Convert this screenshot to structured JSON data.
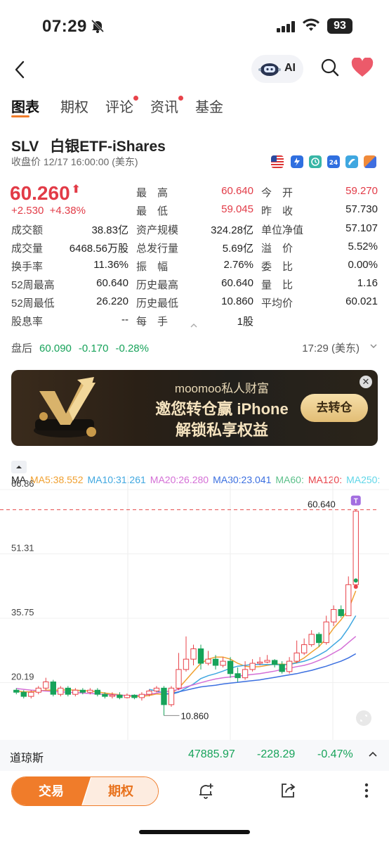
{
  "status_bar": {
    "time": "07:29",
    "battery": "93"
  },
  "nav": {
    "ai_label": "AI"
  },
  "tabs": [
    {
      "label": "图表",
      "active": true,
      "dot": false
    },
    {
      "label": "期权",
      "active": false,
      "dot": false
    },
    {
      "label": "评论",
      "active": false,
      "dot": true
    },
    {
      "label": "资讯",
      "active": false,
      "dot": true
    },
    {
      "label": "基金",
      "active": false,
      "dot": false
    }
  ],
  "quote": {
    "symbol": "SLV",
    "name": "白银ETF-iShares",
    "close_time": "收盘价 12/17 16:00:00 (美东)",
    "price": "60.260",
    "change": "+2.530",
    "change_pct": "+4.38%"
  },
  "stats": [
    {
      "label": "最　高",
      "value": "60.640",
      "color": "red"
    },
    {
      "label": "今　开",
      "value": "59.270",
      "color": "red"
    },
    {
      "label": "最　低",
      "value": "59.045",
      "color": "red"
    },
    {
      "label": "昨　收",
      "value": "57.730",
      "color": ""
    },
    {
      "label": "成交额",
      "value": "38.83亿",
      "color": ""
    },
    {
      "label": "资产规模",
      "value": "324.28亿",
      "color": ""
    },
    {
      "label": "单位净值",
      "value": "57.107",
      "color": ""
    },
    {
      "label": "成交量",
      "value": "6468.56万股",
      "color": ""
    },
    {
      "label": "总发行量",
      "value": "5.69亿",
      "color": ""
    },
    {
      "label": "溢　价",
      "value": "5.52%",
      "color": ""
    },
    {
      "label": "换手率",
      "value": "11.36%",
      "color": ""
    },
    {
      "label": "振　幅",
      "value": "2.76%",
      "color": ""
    },
    {
      "label": "委　比",
      "value": "0.00%",
      "color": ""
    },
    {
      "label": "52周最高",
      "value": "60.640",
      "color": ""
    },
    {
      "label": "历史最高",
      "value": "60.640",
      "color": ""
    },
    {
      "label": "量　比",
      "value": "1.16",
      "color": ""
    },
    {
      "label": "52周最低",
      "value": "26.220",
      "color": ""
    },
    {
      "label": "历史最低",
      "value": "10.860",
      "color": ""
    },
    {
      "label": "平均价",
      "value": "60.021",
      "color": ""
    },
    {
      "label": "股息率",
      "value": "--",
      "color": ""
    },
    {
      "label": "每　手",
      "value": "1股",
      "color": ""
    }
  ],
  "after_hours": {
    "label": "盘后",
    "price": "60.090",
    "change": "-0.170",
    "pct": "-0.28%",
    "time": "17:29 (美东)"
  },
  "banner": {
    "line1": "moomoo私人财富",
    "line2": "邀您转仓赢 iPhone",
    "line3": "解锁私享权益",
    "button": "去转仓"
  },
  "ma_legend": [
    {
      "label": "MA",
      "color": "#222222"
    },
    {
      "label": "MA5:38.552",
      "color": "#f0a030"
    },
    {
      "label": "MA10:31.261",
      "color": "#3fa7e0"
    },
    {
      "label": "MA20:26.280",
      "color": "#d46fd6"
    },
    {
      "label": "MA30:23.041",
      "color": "#3b6fe0"
    },
    {
      "label": "MA60:",
      "color": "#5cc08a"
    },
    {
      "label": "MA120:",
      "color": "#e8434a"
    },
    {
      "label": "MA250:",
      "color": "#5fd6e8"
    }
  ],
  "chart_data": {
    "type": "candlestick",
    "y_ticks": [
      "66.86",
      "51.31",
      "35.75",
      "20.19"
    ],
    "ylim": [
      4.64,
      66.86
    ],
    "high_label": "60.640",
    "low_label": "10.860",
    "marker": "T",
    "candles": [
      [
        17,
        16.5,
        17.5,
        16
      ],
      [
        16.5,
        15.5,
        17,
        15
      ],
      [
        15.5,
        16.5,
        17,
        15
      ],
      [
        16.5,
        17.5,
        18,
        16
      ],
      [
        17.5,
        19,
        20,
        17
      ],
      [
        19,
        16,
        19.5,
        15.5
      ],
      [
        16,
        17.5,
        18,
        15.5
      ],
      [
        17.5,
        16,
        18,
        15.5
      ],
      [
        16,
        17,
        17.5,
        15.5
      ],
      [
        17,
        16.5,
        17.5,
        16
      ],
      [
        16.5,
        17,
        17.5,
        16
      ],
      [
        17,
        16,
        17.5,
        15.5
      ],
      [
        16,
        15.5,
        16.5,
        15
      ],
      [
        15.5,
        15.8,
        16.5,
        15
      ],
      [
        15.8,
        15.2,
        16.5,
        14.8
      ],
      [
        15.2,
        15.8,
        16.2,
        15
      ],
      [
        15.8,
        15.2,
        16,
        14.8
      ],
      [
        15.2,
        16,
        16.5,
        14.5
      ],
      [
        16,
        16.8,
        17.2,
        15.5
      ],
      [
        16.8,
        17.5,
        18,
        16.5
      ],
      [
        17.5,
        13.5,
        18,
        10.86
      ],
      [
        13.5,
        17.5,
        18,
        13
      ],
      [
        17.5,
        22,
        26,
        17
      ],
      [
        22,
        24.5,
        30,
        21.5
      ],
      [
        24.5,
        27,
        28,
        23
      ],
      [
        27,
        23.5,
        28,
        22
      ],
      [
        23.5,
        24.5,
        26.5,
        23
      ],
      [
        24.5,
        23,
        25.5,
        22
      ],
      [
        23,
        24,
        25,
        22.5
      ],
      [
        24,
        21,
        25,
        20
      ],
      [
        21,
        20,
        22.5,
        19
      ],
      [
        20,
        22,
        24,
        19.5
      ],
      [
        22,
        23.5,
        24.5,
        21.5
      ],
      [
        23.5,
        23.8,
        25,
        23
      ],
      [
        23.8,
        24.2,
        25.5,
        23.5
      ],
      [
        24.2,
        23.2,
        24.5,
        22.5
      ],
      [
        23.2,
        21.5,
        24,
        21
      ],
      [
        21.5,
        24,
        25,
        21
      ],
      [
        24,
        26,
        29,
        23.5
      ],
      [
        26,
        28,
        29.5,
        25.5
      ],
      [
        28,
        30.5,
        31.5,
        27.5
      ],
      [
        30.5,
        28.5,
        31,
        27.5
      ],
      [
        28.5,
        33.5,
        35,
        28
      ],
      [
        33.5,
        36.5,
        37.5,
        32.5
      ],
      [
        36.5,
        35,
        37.5,
        34.5
      ],
      [
        35,
        42.5,
        44.5,
        35
      ],
      [
        42.5,
        60.26,
        60.64,
        42
      ]
    ],
    "ma_lines": [
      {
        "name": "MA5",
        "color": "#f0a030",
        "values": [
          16.8,
          16.6,
          16.6,
          16.8,
          17,
          17,
          17,
          17.1,
          17,
          16.9,
          16.8,
          16.6,
          16.3,
          16.1,
          15.9,
          15.6,
          15.5,
          15.5,
          15.7,
          16.1,
          16,
          16.2,
          17.5,
          19.5,
          21.5,
          23.5,
          24.5,
          25,
          25,
          24.5,
          23.5,
          22.8,
          22.6,
          22.7,
          23,
          23.3,
          23.3,
          23.2,
          23.8,
          24.8,
          26.2,
          27.5,
          29.5,
          32,
          34,
          36.5,
          41
        ]
      },
      {
        "name": "MA10",
        "color": "#3fa7e0",
        "values": [
          null,
          null,
          null,
          null,
          null,
          null,
          null,
          null,
          null,
          null,
          null,
          null,
          null,
          null,
          null,
          null,
          null,
          null,
          17.2,
          16.8,
          16.3,
          16,
          16.5,
          17.5,
          18.5,
          19.8,
          20.5,
          21,
          21.6,
          22.3,
          22.8,
          23,
          23.2,
          23.2,
          23.2,
          23.2,
          23.1,
          23.2,
          23.6,
          24,
          24.6,
          25.5,
          26.5,
          28,
          29.5,
          32,
          35
        ]
      },
      {
        "name": "MA20",
        "color": "#d46fd6",
        "values": [
          17.4,
          17.2,
          17,
          16.9,
          16.8,
          16.7,
          16.6,
          16.5,
          16.4,
          16.3,
          16.2,
          16.1,
          16,
          15.9,
          15.8,
          15.7,
          15.7,
          15.8,
          16,
          16.3,
          16.6,
          16.8,
          17.2,
          17.8,
          18.3,
          18.8,
          19.3,
          19.7,
          20,
          20.2,
          20.4,
          20.6,
          20.8,
          21,
          21.3,
          21.6,
          22,
          22.3,
          22.7,
          23,
          23.5,
          24.2,
          25,
          26,
          27,
          28.5,
          30
        ]
      },
      {
        "name": "MA30",
        "color": "#3b6fe0",
        "values": [
          null,
          null,
          null,
          null,
          null,
          null,
          null,
          null,
          null,
          null,
          null,
          null,
          null,
          null,
          null,
          null,
          null,
          null,
          null,
          null,
          16,
          16.2,
          16.6,
          17,
          17.4,
          17.8,
          18,
          18.2,
          18.5,
          18.7,
          18.9,
          19.1,
          19.3,
          19.5,
          19.8,
          20.1,
          20.4,
          20.7,
          21,
          21.4,
          21.8,
          22.3,
          22.8,
          23.4,
          24,
          24.8,
          25.8
        ]
      }
    ]
  },
  "index": {
    "name": "道琼斯",
    "value": "47885.97",
    "change": "-228.29",
    "pct": "-0.47%"
  },
  "bottom": {
    "trade": "交易",
    "options": "期权"
  }
}
